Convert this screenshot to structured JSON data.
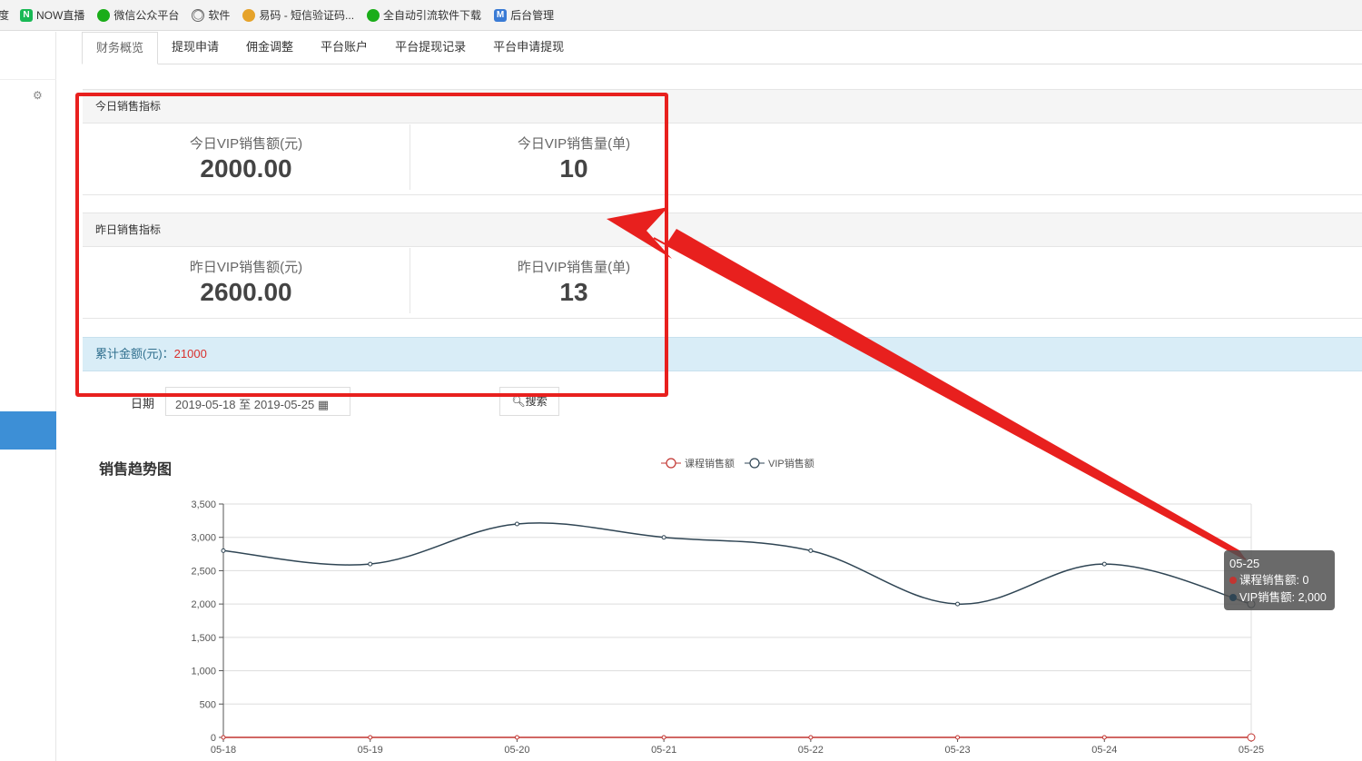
{
  "bookmarks": [
    {
      "label": "度",
      "icon": "none",
      "color": ""
    },
    {
      "label": "NOW直播",
      "icon": "now-icon",
      "color": "#19b955"
    },
    {
      "label": "微信公众平台",
      "icon": "wechat-icon",
      "color": "#1aad19"
    },
    {
      "label": "软件",
      "icon": "globe-icon",
      "color": "#666666"
    },
    {
      "label": "易码 - 短信验证码...",
      "icon": "yima-icon",
      "color": "#e6a32a"
    },
    {
      "label": "全自动引流软件下载",
      "icon": "wechat-icon",
      "color": "#1aad19"
    },
    {
      "label": "后台管理",
      "icon": "m-icon",
      "color": "#3a7bd5"
    }
  ],
  "tabs": [
    "财务概览",
    "提现申请",
    "佣金调整",
    "平台账户",
    "平台提现记录",
    "平台申请提现"
  ],
  "today": {
    "title": "今日销售指标",
    "amount_label": "今日VIP销售额(元)",
    "amount_value": "2000.00",
    "count_label": "今日VIP销售量(单)",
    "count_value": "10"
  },
  "yesterday": {
    "title": "昨日销售指标",
    "amount_label": "昨日VIP销售额(元)",
    "amount_value": "2600.00",
    "count_label": "昨日VIP销售量(单)",
    "count_value": "13"
  },
  "total": {
    "label": "累计金额(元)：",
    "value": "21000"
  },
  "filter": {
    "date_label": "日期",
    "date_value": "2019-05-18 至 2019-05-25",
    "search_label": "搜索"
  },
  "colors": {
    "accent": "#3d8fd6",
    "annotation": "#e8201e",
    "course_series": "#c23531",
    "vip_series": "#2f4554"
  },
  "chart_data": {
    "type": "line",
    "title": "销售趋势图",
    "categories": [
      "05-18",
      "05-19",
      "05-20",
      "05-21",
      "05-22",
      "05-23",
      "05-24",
      "05-25"
    ],
    "series": [
      {
        "name": "课程销售额",
        "values": [
          0,
          0,
          0,
          0,
          0,
          0,
          0,
          0
        ]
      },
      {
        "name": "VIP销售额",
        "values": [
          2800,
          2600,
          3200,
          3000,
          2800,
          2000,
          2600,
          2000
        ]
      }
    ],
    "ylim": [
      0,
      3500
    ],
    "yticks": [
      "0",
      "500",
      "1,000",
      "1,500",
      "2,000",
      "2,500",
      "3,000",
      "3,500"
    ],
    "grid": true,
    "legend": "top-center"
  },
  "tooltip": {
    "date": "05-25",
    "line1": "课程销售额: 0",
    "line2": "VIP销售额: 2,000"
  }
}
